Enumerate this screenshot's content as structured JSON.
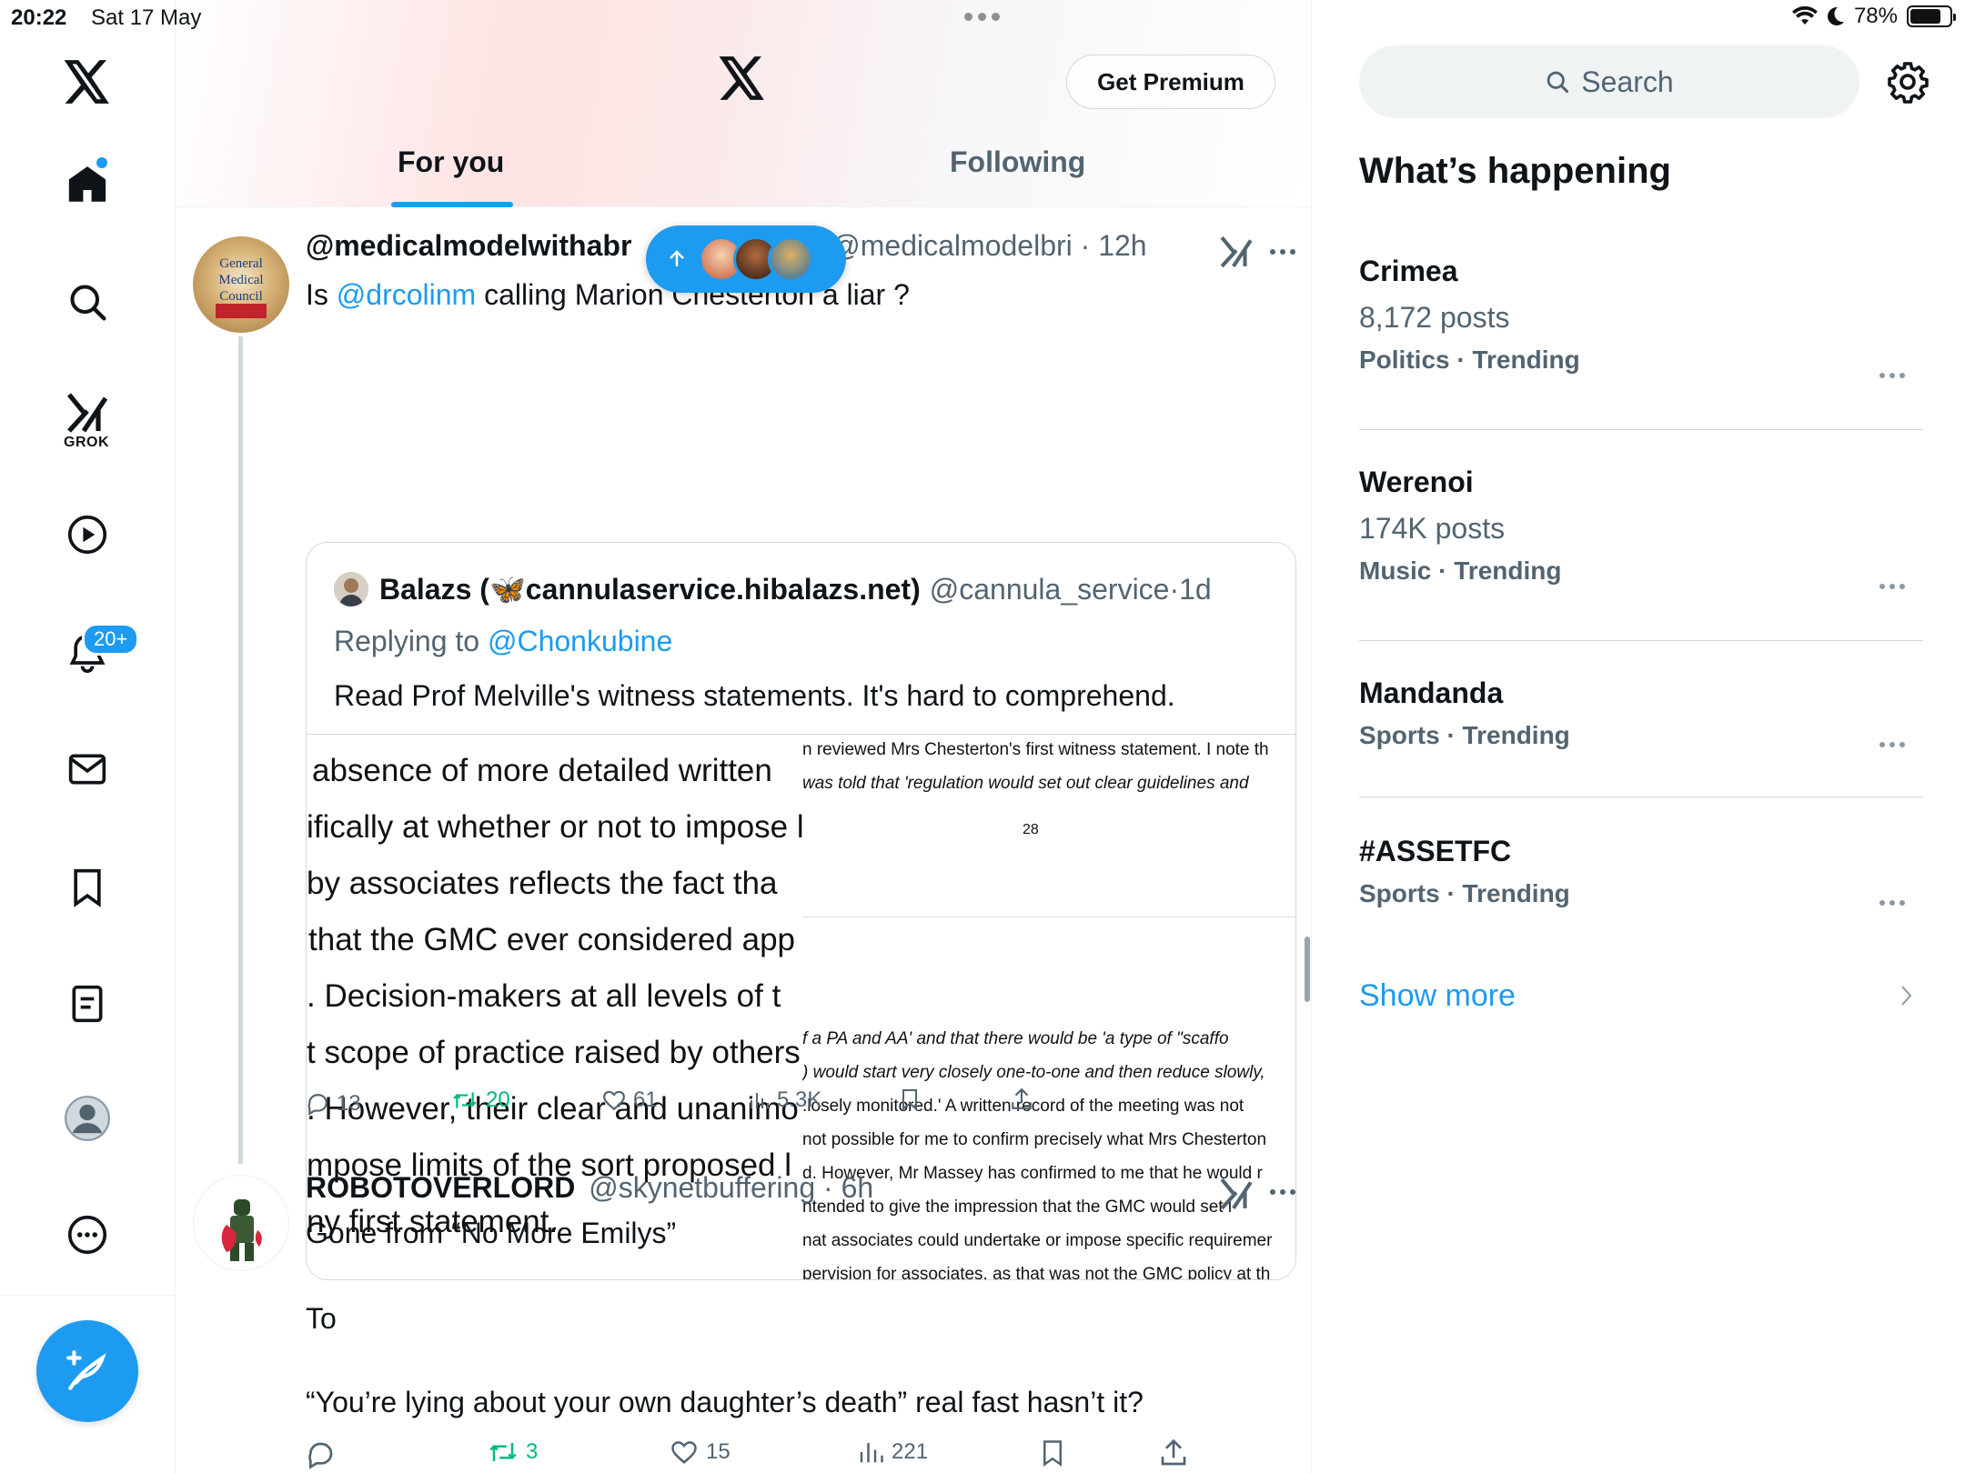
{
  "status_bar": {
    "time": "20:22",
    "date": "Sat 17 May",
    "battery": "78%",
    "battery_level": 0.78
  },
  "nav": {
    "items": [
      "home-icon",
      "search-icon",
      "grok-icon",
      "video-icon",
      "notifications-icon",
      "messages-icon",
      "bookmarks-icon",
      "lists-icon",
      "profile-icon",
      "more-icon"
    ],
    "grok_label": "GROK",
    "notifications_badge": "20+"
  },
  "header": {
    "get_premium": "Get Premium",
    "tabs": [
      {
        "label": "For you",
        "active": true
      },
      {
        "label": "Following",
        "active": false
      }
    ]
  },
  "tweets": [
    {
      "display_name": "@medicalmodelwithabr",
      "handle": "@medicalmodelbri",
      "time": "12h",
      "text_prefix": "Is ",
      "mention": "@drcolinm",
      "text_suffix": " calling Marion Chesterton a liar ?",
      "quote": {
        "name": "Balazs (🦋cannulaservice.hibalazs.net)",
        "handle": "@cannula_service",
        "time": "1d",
        "replying_prefix": "Replying to ",
        "replying_to": "@Chonkubine",
        "text": "Read Prof Melville's witness statements. It's hard to comprehend.",
        "doc_left_lines": [
          "absence  of  more  detailed  written",
          "ifically at whether or not to impose lir",
          "  by  associates  reflects  the  fact  tha",
          "that the GMC ever considered app",
          ".  Decision-makers  at  all  levels  of  t",
          "t scope of practice raised by others",
          ".  However,  their  clear  and  unanimo",
          "mpose  limits  of  the  sort  proposed  l",
          "ny first statement."
        ],
        "doc_right_lines": [
          "n reviewed Mrs Chesterton's first witness statement. I note th",
          " was told that 'regulation would set out clear guidelines and",
          "28",
          "f a PA and AA' and that there would be 'a type of \"scaffo",
          ") would start very closely one-to-one and then reduce slowly,",
          ":losely monitored.' A written record of the meeting was not",
          "not possible for me to confirm precisely what Mrs Chesterton",
          "d. However, Mr Massey has confirmed to me that he would r",
          "ntended to give the impression that the GMC would set l",
          "nat associates could undertake or impose specific requiremer",
          "pervision for associates, as that was not the GMC policy at th"
        ]
      },
      "stats": {
        "replies": "13",
        "reposts": "20",
        "likes": "61",
        "views": "5.3K"
      }
    },
    {
      "display_name": "ROBOTOVERLORD",
      "handle": "@skynetbuffering",
      "time": "6h",
      "text_lines": [
        "Gone from “No More Emilys”",
        "To",
        "“You’re lying about your own daughter’s death” real fast hasn’t it?"
      ],
      "stats": {
        "replies": "",
        "reposts": "3",
        "likes": "15",
        "views": "221"
      }
    }
  ],
  "sidebar": {
    "search_placeholder": "Search",
    "section_title": "What’s happening",
    "trends": [
      {
        "title": "Crimea",
        "count": "8,172 posts",
        "category": "Politics · Trending"
      },
      {
        "title": "Werenoi",
        "count": "174K posts",
        "category": "Music · Trending"
      },
      {
        "title": "Mandanda",
        "count": "",
        "category": "Sports · Trending"
      },
      {
        "title": "#ASSETFC",
        "count": "",
        "category": "Sports · Trending"
      }
    ],
    "show_more": "Show more"
  },
  "colors": {
    "accent": "#1d9bf0",
    "text": "#0f1419",
    "secondary": "#536471",
    "repost": "#00ba7c"
  }
}
